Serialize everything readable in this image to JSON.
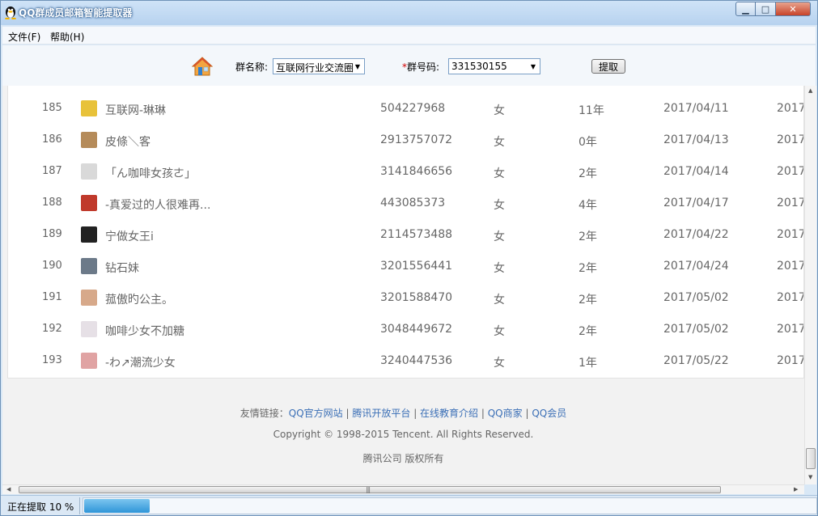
{
  "window": {
    "title": "QQ群成员邮箱智能提取器",
    "buttons": {
      "minimize": "▁",
      "maximize": "□",
      "close": "✕"
    }
  },
  "menu": [
    {
      "label": "文件(F)"
    },
    {
      "label": "帮助(H)"
    }
  ],
  "toolbar": {
    "group_name_label": "群名称:",
    "group_name_value": "互联网行业交流圈",
    "required_mark": "*",
    "group_id_label": "群号码:",
    "group_id_value": "331530155",
    "fetch_button": "提取"
  },
  "members": [
    {
      "index": "185",
      "nickname": "互联网-琳琳",
      "qq": "504227968",
      "gender": "女",
      "qq_age": "11年",
      "join_date": "2017/04/11",
      "last_date": "2017/",
      "avatar_color": "#e8c23a"
    },
    {
      "index": "186",
      "nickname": "皮條＼客",
      "qq": "2913757072",
      "gender": "女",
      "qq_age": "0年",
      "join_date": "2017/04/13",
      "last_date": "2017/",
      "avatar_color": "#b58b5a"
    },
    {
      "index": "187",
      "nickname": "「ん咖啡女孩ㄜ」",
      "qq": "3141846656",
      "gender": "女",
      "qq_age": "2年",
      "join_date": "2017/04/14",
      "last_date": "2017/",
      "avatar_color": "#d9d9d9"
    },
    {
      "index": "188",
      "nickname": "-真爱过的人很难再...",
      "qq": "443085373",
      "gender": "女",
      "qq_age": "4年",
      "join_date": "2017/04/17",
      "last_date": "2017/",
      "avatar_color": "#c0392b"
    },
    {
      "index": "189",
      "nickname": "宁做女王i",
      "qq": "2114573488",
      "gender": "女",
      "qq_age": "2年",
      "join_date": "2017/04/22",
      "last_date": "2017/",
      "avatar_color": "#222222"
    },
    {
      "index": "190",
      "nickname": "钻石妹",
      "qq": "3201556441",
      "gender": "女",
      "qq_age": "2年",
      "join_date": "2017/04/24",
      "last_date": "2017/",
      "avatar_color": "#6c7a89"
    },
    {
      "index": "191",
      "nickname": "菰傲旳公主。",
      "qq": "3201588470",
      "gender": "女",
      "qq_age": "2年",
      "join_date": "2017/05/02",
      "last_date": "2017/",
      "avatar_color": "#d7a98a"
    },
    {
      "index": "192",
      "nickname": "咖啡少女不加糖",
      "qq": "3048449672",
      "gender": "女",
      "qq_age": "2年",
      "join_date": "2017/05/02",
      "last_date": "2017/",
      "avatar_color": "#e6e0e6"
    },
    {
      "index": "193",
      "nickname": "-わ↗潮流少女",
      "qq": "3240447536",
      "gender": "女",
      "qq_age": "1年",
      "join_date": "2017/05/22",
      "last_date": "2017/",
      "avatar_color": "#e0a3a3"
    }
  ],
  "footer": {
    "links_prefix": "友情链接：",
    "links": [
      "QQ官方网站",
      "腾讯开放平台",
      "在线教育介绍",
      "QQ商家",
      "QQ会员"
    ],
    "separator": " | ",
    "copyright": "Copyright © 1998-2015 Tencent. All Rights Reserved.",
    "company": "腾讯公司 版权所有"
  },
  "status": {
    "text": "正在提取 10 %",
    "progress": 0.09
  }
}
